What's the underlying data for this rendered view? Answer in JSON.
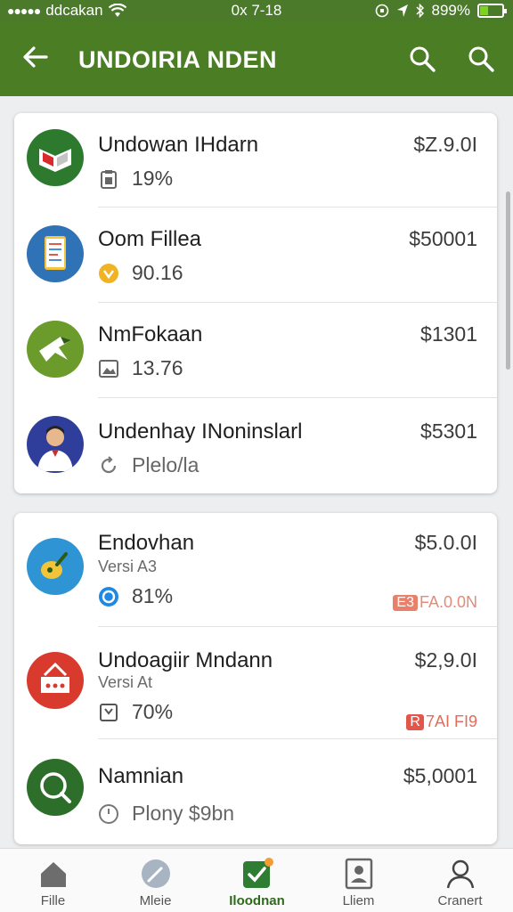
{
  "status_bar": {
    "carrier": "ddcakan",
    "time": "0x 7-18",
    "battery_text": "899%"
  },
  "app_bar": {
    "title": "UNDOIRIA NDEN"
  },
  "colors": {
    "app_bar": "#4b7d25",
    "accent": "#2e7d32",
    "badge_orange": "#e8806a",
    "badge_red": "#e2574a"
  },
  "card1": {
    "items": [
      {
        "name": "Undowan IHdarn",
        "price": "$Z.9.0I",
        "meta": "19%",
        "meta_icon": "clipboard-icon",
        "avatar_icon": "book-logo-icon"
      },
      {
        "name": "Oom Fillea",
        "price": "$50001",
        "meta": "90.16",
        "meta_icon": "gold-coin-icon",
        "avatar_icon": "document-app-icon"
      },
      {
        "name": "NmFokaan",
        "price": "$1301",
        "meta": "13.76",
        "meta_icon": "image-icon",
        "avatar_icon": "bird-logo-icon"
      },
      {
        "name": "Undenhay INoninslarl",
        "price": "$5301",
        "meta": "Plelo/la",
        "meta_icon": "refresh-icon",
        "avatar_icon": "person-avatar-icon"
      }
    ]
  },
  "card2": {
    "items": [
      {
        "name": "Endovhan",
        "sub": "Versi A3",
        "price": "$5.0.0I",
        "meta": "81%",
        "meta_icon": "blue-circle-icon",
        "badge_tag": "E3",
        "badge_text": "FA.0.0N",
        "avatar_icon": "music-note-icon"
      },
      {
        "name": "Undoagiir Mndann",
        "sub": "Versi At",
        "price": "$2,9.0I",
        "meta": "70%",
        "meta_icon": "bookmark-icon",
        "badge_tag": "R",
        "badge_text": "7AI FI9",
        "avatar_icon": "store-logo-icon"
      },
      {
        "name": "Namnian",
        "price": "$5,0001",
        "meta": "Plony $9bn",
        "meta_icon": "clock-icon",
        "avatar_icon": "magnifier-logo-icon"
      }
    ]
  },
  "bottom_nav": [
    {
      "label": "Fille",
      "icon": "home-icon"
    },
    {
      "label": "Mleie",
      "icon": "compass-icon"
    },
    {
      "label": "Iloodnan",
      "icon": "check-icon",
      "active": true
    },
    {
      "label": "Lliem",
      "icon": "portrait-icon"
    },
    {
      "label": "Cranert",
      "icon": "person-icon"
    }
  ]
}
